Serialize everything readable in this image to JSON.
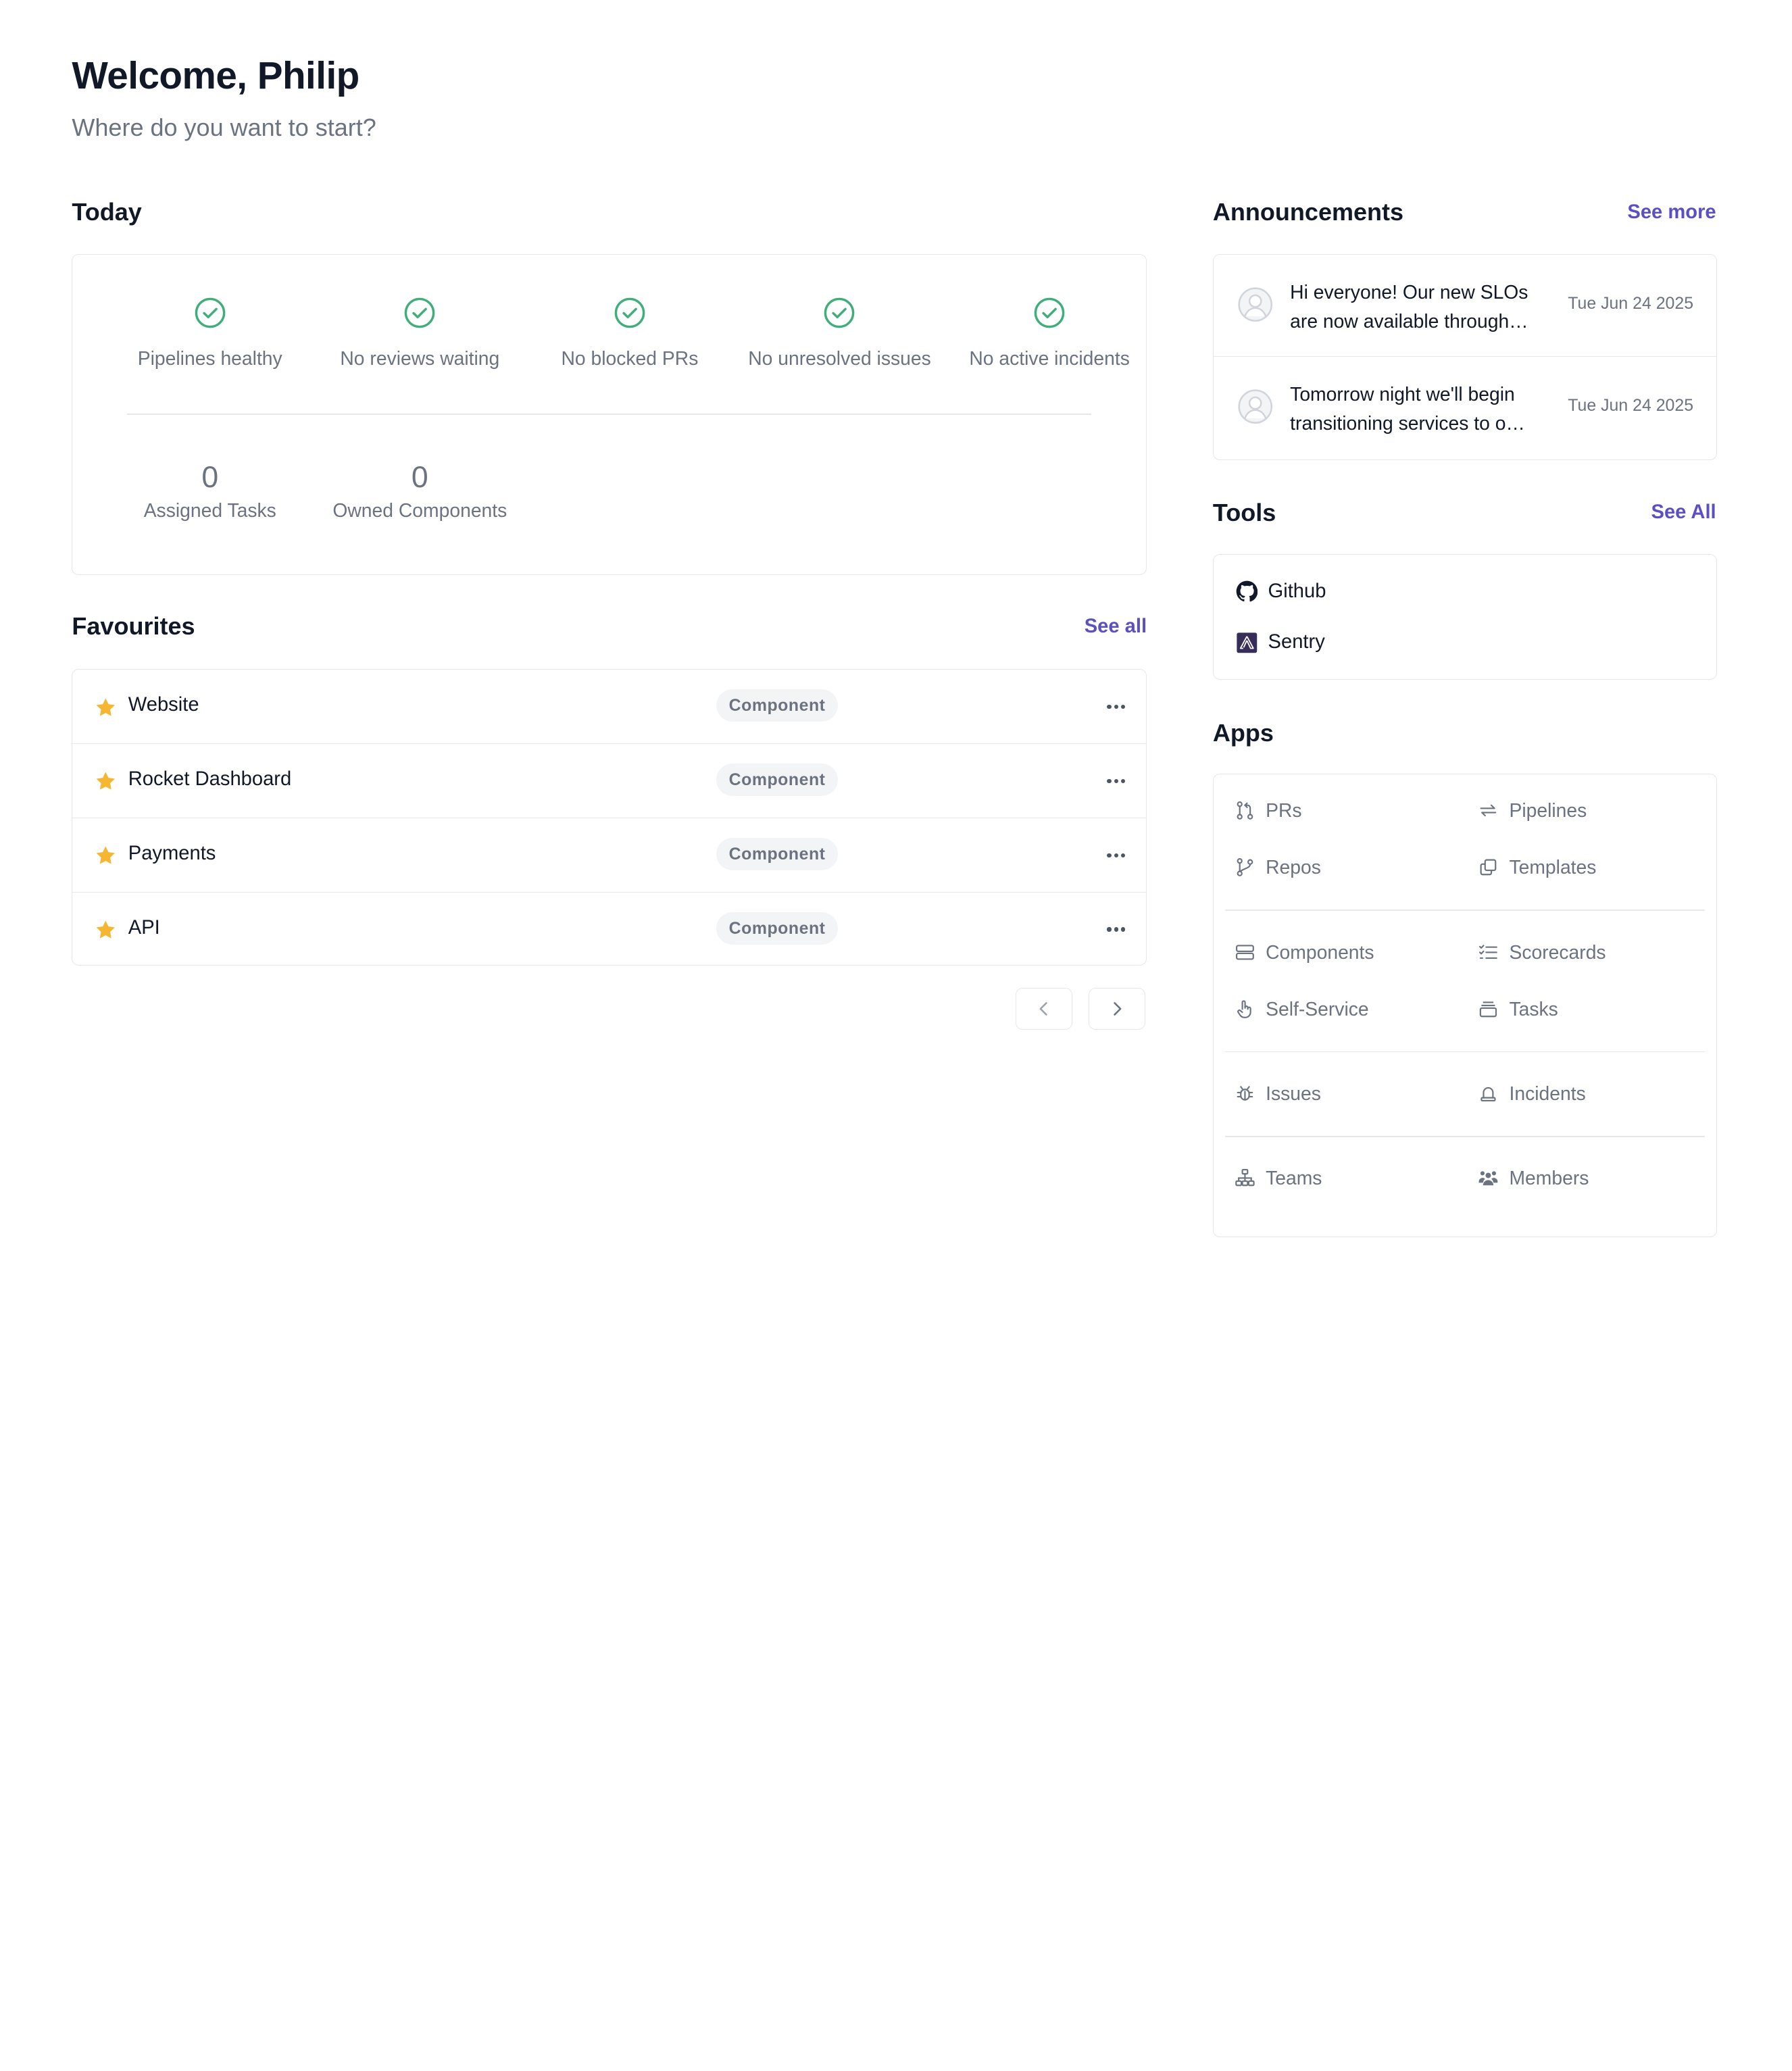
{
  "header": {
    "title": "Welcome, Philip",
    "subtitle": "Where do you want to start?"
  },
  "today": {
    "title": "Today",
    "statuses": [
      {
        "label": "Pipelines healthy",
        "icon": "check-circle-icon"
      },
      {
        "label": "No reviews waiting",
        "icon": "check-circle-icon"
      },
      {
        "label": "No blocked PRs",
        "icon": "check-circle-icon"
      },
      {
        "label": "No unresolved issues",
        "icon": "check-circle-icon"
      },
      {
        "label": "No active incidents",
        "icon": "check-circle-icon"
      }
    ],
    "stats": [
      {
        "value": "0",
        "label": "Assigned Tasks"
      },
      {
        "value": "0",
        "label": "Owned Components"
      }
    ]
  },
  "favourites": {
    "title": "Favourites",
    "see_all": "See all",
    "items": [
      {
        "name": "Website",
        "type": "Component"
      },
      {
        "name": "Rocket Dashboard",
        "type": "Component"
      },
      {
        "name": "Payments",
        "type": "Component"
      },
      {
        "name": "API",
        "type": "Component"
      }
    ]
  },
  "announcements": {
    "title": "Announcements",
    "see_more": "See more",
    "items": [
      {
        "text": "Hi everyone! Our new SLOs are now available through…",
        "date": "Tue Jun 24 2025"
      },
      {
        "text": "Tomorrow night we'll begin transitioning services to o…",
        "date": "Tue Jun 24 2025"
      }
    ]
  },
  "tools": {
    "title": "Tools",
    "see_all": "See All",
    "items": [
      {
        "name": "Github",
        "icon": "github-icon"
      },
      {
        "name": "Sentry",
        "icon": "sentry-icon"
      }
    ]
  },
  "apps": {
    "title": "Apps",
    "items": [
      {
        "name": "PRs",
        "icon": "pull-request-icon"
      },
      {
        "name": "Pipelines",
        "icon": "repeat-arrows-icon"
      },
      {
        "name": "Repos",
        "icon": "git-branch-icon"
      },
      {
        "name": "Templates",
        "icon": "copy-icon"
      },
      {
        "name": "Components",
        "icon": "server-icon"
      },
      {
        "name": "Scorecards",
        "icon": "checklist-icon"
      },
      {
        "name": "Self-Service",
        "icon": "pointer-hand-icon"
      },
      {
        "name": "Tasks",
        "icon": "tray-icon"
      },
      {
        "name": "Issues",
        "icon": "bug-icon"
      },
      {
        "name": "Incidents",
        "icon": "siren-icon"
      },
      {
        "name": "Teams",
        "icon": "org-chart-icon"
      },
      {
        "name": "Members",
        "icon": "users-icon"
      }
    ]
  },
  "colors": {
    "accent": "#5b4fc4",
    "success": "#3fae7a",
    "star": "#f5b731",
    "muted_text": "#6b7280",
    "border": "#e5e7eb"
  }
}
